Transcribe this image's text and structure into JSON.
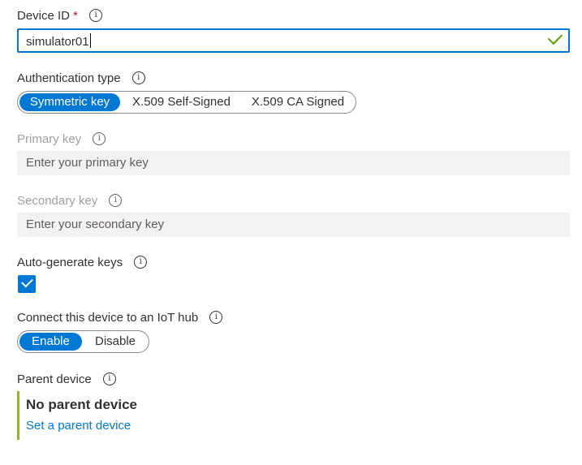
{
  "device_id": {
    "label": "Device ID",
    "required_mark": "*",
    "value": "simulator01",
    "valid_color": "#57a300"
  },
  "auth_type": {
    "label": "Authentication type",
    "options": [
      "Symmetric key",
      "X.509 Self-Signed",
      "X.509 CA Signed"
    ],
    "selected": "Symmetric key"
  },
  "primary_key": {
    "label": "Primary key",
    "placeholder": "Enter your primary key"
  },
  "secondary_key": {
    "label": "Secondary key",
    "placeholder": "Enter your secondary key"
  },
  "auto_generate": {
    "label": "Auto-generate keys",
    "checked": true
  },
  "connect_hub": {
    "label": "Connect this device to an IoT hub",
    "options": [
      "Enable",
      "Disable"
    ],
    "selected": "Enable"
  },
  "parent_device": {
    "label": "Parent device",
    "value": "No parent device",
    "link": "Set a parent device"
  },
  "info_glyph": "i",
  "colors": {
    "accent": "#0078d4",
    "required": "#a4262c",
    "parent_bar": "#8cbd18"
  }
}
